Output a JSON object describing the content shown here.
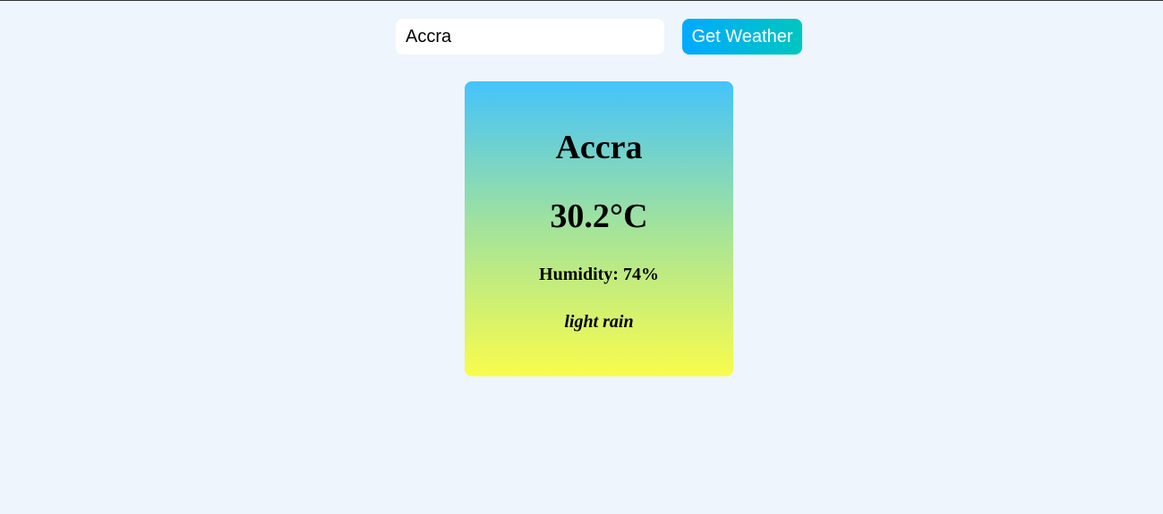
{
  "search": {
    "input_value": "Accra",
    "button_label": "Get Weather"
  },
  "weather": {
    "city": "Accra",
    "temperature": "30.2°C",
    "humidity": "Humidity: 74%",
    "description": "light rain"
  },
  "colors": {
    "page_background": "#eef5fc",
    "button_gradient_start": "#00aaff",
    "button_gradient_end": "#00c6c0",
    "card_gradient_top": "#44c3fb",
    "card_gradient_bottom": "#f9fc4c"
  }
}
